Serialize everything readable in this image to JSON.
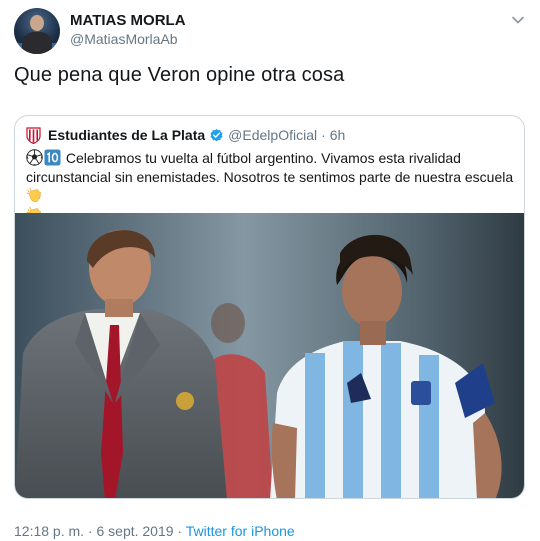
{
  "tweet": {
    "author_name": "MATIAS MORLA",
    "author_handle": "@MatiasMorlaAb",
    "text": "Que pena que Veron opine otra cosa",
    "timestamp": "12:18 p. m. · 6 sept. 2019 · ",
    "source": "Twitter for iPhone",
    "menu_icon": "chevron-down-icon"
  },
  "quoted": {
    "author_name": "Estudiantes de La Plata",
    "author_handle": "@EdelpOficial",
    "separator": "·",
    "time": "6h",
    "text": "Celebramos tu vuelta al fútbol argentino. Vivamos esta rivalidad circunstancial sin enemistades. Nosotros te sentimos parte de nuestra escuela",
    "leading_emojis": [
      "soccer-ball-emoji",
      "keycap-10-emoji"
    ],
    "trailing_emojis": [
      "clapping-hands-emoji",
      "clapping-hands-emoji"
    ],
    "verified": true
  },
  "colors": {
    "link": "#1b95e0",
    "secondary_text": "#657786",
    "verified_badge": "#1da1f2",
    "border": "#ccd6dd"
  }
}
